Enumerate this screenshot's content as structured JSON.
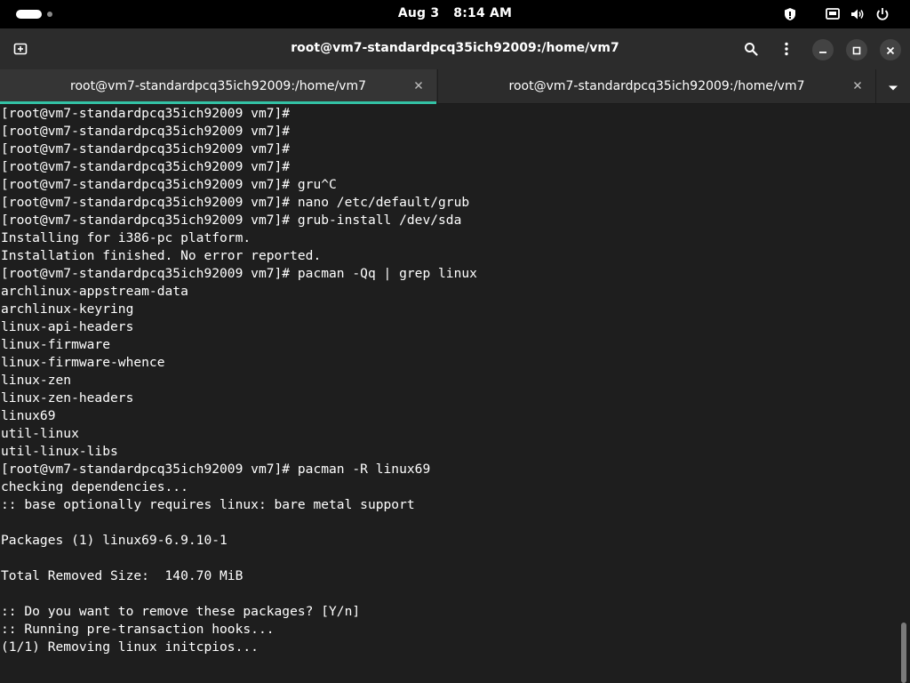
{
  "topbar": {
    "date": "Aug 3",
    "time": "8:14 AM",
    "icons": [
      "privacy-shield-icon",
      "network-wired-icon",
      "volume-icon",
      "power-icon"
    ]
  },
  "window": {
    "title": "root@vm7-standardpcq35ich92009:/home/vm7",
    "icons": [
      "new-tab-icon",
      "search-icon",
      "menu-kebab-icon",
      "minimize-icon",
      "maximize-icon",
      "close-icon"
    ]
  },
  "tabs": [
    {
      "label": "root@vm7-standardpcq35ich92009:/home/vm7",
      "active": true
    },
    {
      "label": "root@vm7-standardpcq35ich92009:/home/vm7",
      "active": false
    }
  ],
  "terminal": {
    "lines": [
      "[root@vm7-standardpcq35ich92009 vm7]#",
      "[root@vm7-standardpcq35ich92009 vm7]#",
      "[root@vm7-standardpcq35ich92009 vm7]#",
      "[root@vm7-standardpcq35ich92009 vm7]#",
      "[root@vm7-standardpcq35ich92009 vm7]# gru^C",
      "[root@vm7-standardpcq35ich92009 vm7]# nano /etc/default/grub",
      "[root@vm7-standardpcq35ich92009 vm7]# grub-install /dev/sda",
      "Installing for i386-pc platform.",
      "Installation finished. No error reported.",
      "[root@vm7-standardpcq35ich92009 vm7]# pacman -Qq | grep linux",
      "archlinux-appstream-data",
      "archlinux-keyring",
      "linux-api-headers",
      "linux-firmware",
      "linux-firmware-whence",
      "linux-zen",
      "linux-zen-headers",
      "linux69",
      "util-linux",
      "util-linux-libs",
      "[root@vm7-standardpcq35ich92009 vm7]# pacman -R linux69",
      "checking dependencies...",
      ":: base optionally requires linux: bare metal support",
      "",
      "Packages (1) linux69-6.9.10-1",
      "",
      "Total Removed Size:  140.70 MiB",
      "",
      ":: Do you want to remove these packages? [Y/n]",
      ":: Running pre-transaction hooks...",
      "(1/1) Removing linux initcpios..."
    ]
  },
  "colors": {
    "topbar": "#000000",
    "headerbar": "#2c2c2c",
    "terminal_bg": "#1e1e1e",
    "terminal_fg": "#ffffff",
    "tab_accent": "#33c2a5"
  }
}
